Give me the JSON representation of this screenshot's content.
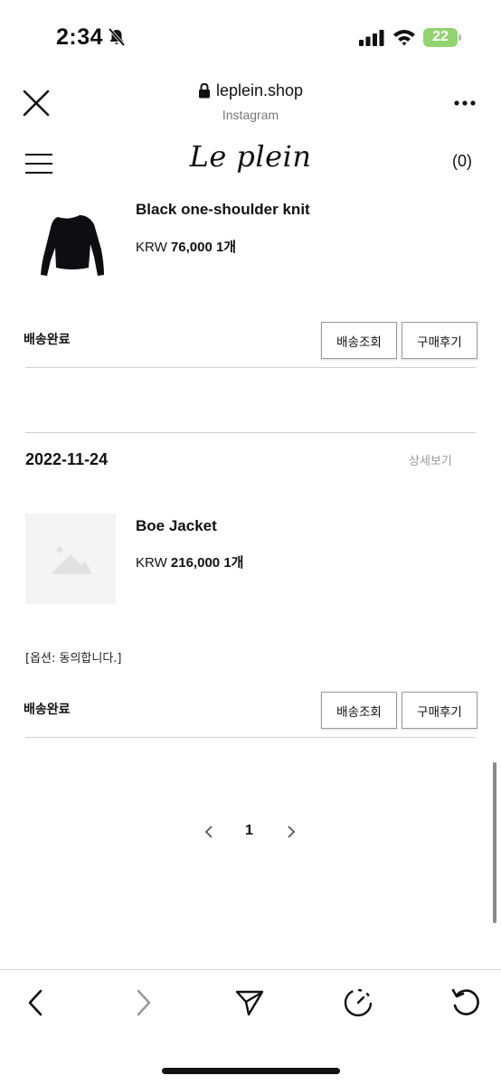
{
  "status_bar": {
    "time": "2:34",
    "battery": "22"
  },
  "browser": {
    "url": "leplein.shop",
    "source": "Instagram"
  },
  "site": {
    "logo": "Le plein",
    "cart_count": "(0)"
  },
  "orders": [
    {
      "items": [
        {
          "name": "Black one-shoulder knit",
          "currency": "KRW",
          "price": "76,000",
          "qty": "1개"
        }
      ],
      "status": "배송완료",
      "track_label": "배송조회",
      "review_label": "구매후기"
    },
    {
      "date": "2022-11-24",
      "detail_label": "상세보기",
      "items": [
        {
          "name": "Boe Jacket",
          "currency": "KRW",
          "price": "216,000",
          "qty": "1개",
          "option": "[옵션: 동의합니다.]"
        }
      ],
      "status": "배송완료",
      "track_label": "배송조회",
      "review_label": "구매후기"
    }
  ],
  "pagination": {
    "current": "1"
  },
  "icons": {
    "back": "chevron-left-icon",
    "forward": "chevron-right-icon",
    "share": "paper-plane-icon",
    "timer": "timer-icon",
    "reload": "reload-icon"
  },
  "colors": {
    "battery": "#8fd46e",
    "divider": "#cfcfcf",
    "muted": "#999999"
  }
}
